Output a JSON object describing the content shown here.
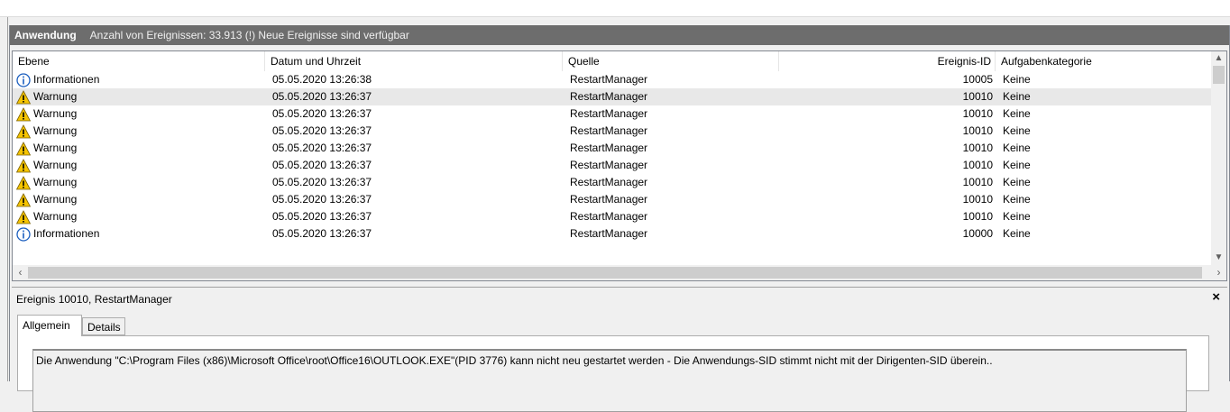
{
  "header": {
    "title": "Anwendung",
    "count_text": "Anzahl von Ereignissen: 33.913 (!) Neue Ereignisse sind verfügbar"
  },
  "columns": {
    "level": "Ebene",
    "date": "Datum und Uhrzeit",
    "source": "Quelle",
    "event_id": "Ereignis-ID",
    "task": "Aufgabenkategorie"
  },
  "rows": [
    {
      "icon": "info-icon",
      "level": "Informationen",
      "date": "05.05.2020 13:26:38",
      "source": "RestartManager",
      "event_id": "10005",
      "task": "Keine"
    },
    {
      "icon": "warning-icon",
      "level": "Warnung",
      "date": "05.05.2020 13:26:37",
      "source": "RestartManager",
      "event_id": "10010",
      "task": "Keine",
      "selected": true
    },
    {
      "icon": "warning-icon",
      "level": "Warnung",
      "date": "05.05.2020 13:26:37",
      "source": "RestartManager",
      "event_id": "10010",
      "task": "Keine"
    },
    {
      "icon": "warning-icon",
      "level": "Warnung",
      "date": "05.05.2020 13:26:37",
      "source": "RestartManager",
      "event_id": "10010",
      "task": "Keine"
    },
    {
      "icon": "warning-icon",
      "level": "Warnung",
      "date": "05.05.2020 13:26:37",
      "source": "RestartManager",
      "event_id": "10010",
      "task": "Keine"
    },
    {
      "icon": "warning-icon",
      "level": "Warnung",
      "date": "05.05.2020 13:26:37",
      "source": "RestartManager",
      "event_id": "10010",
      "task": "Keine"
    },
    {
      "icon": "warning-icon",
      "level": "Warnung",
      "date": "05.05.2020 13:26:37",
      "source": "RestartManager",
      "event_id": "10010",
      "task": "Keine"
    },
    {
      "icon": "warning-icon",
      "level": "Warnung",
      "date": "05.05.2020 13:26:37",
      "source": "RestartManager",
      "event_id": "10010",
      "task": "Keine"
    },
    {
      "icon": "warning-icon",
      "level": "Warnung",
      "date": "05.05.2020 13:26:37",
      "source": "RestartManager",
      "event_id": "10010",
      "task": "Keine"
    },
    {
      "icon": "info-icon",
      "level": "Informationen",
      "date": "05.05.2020 13:26:37",
      "source": "RestartManager",
      "event_id": "10000",
      "task": "Keine"
    }
  ],
  "detail": {
    "title": "Ereignis 10010, RestartManager",
    "close": "×",
    "tabs": [
      "Allgemein",
      "Details"
    ],
    "message": "Die Anwendung \"C:\\Program Files (x86)\\Microsoft Office\\root\\Office16\\OUTLOOK.EXE\"(PID 3776) kann  nicht neu gestartet werden - Die Anwendungs-SID stimmt nicht mit der Dirigenten-SID überein.."
  },
  "colors": {
    "header_bg": "#6d6d6d",
    "warning_fill": "#f5c400",
    "info_stroke": "#1c5fbf"
  }
}
